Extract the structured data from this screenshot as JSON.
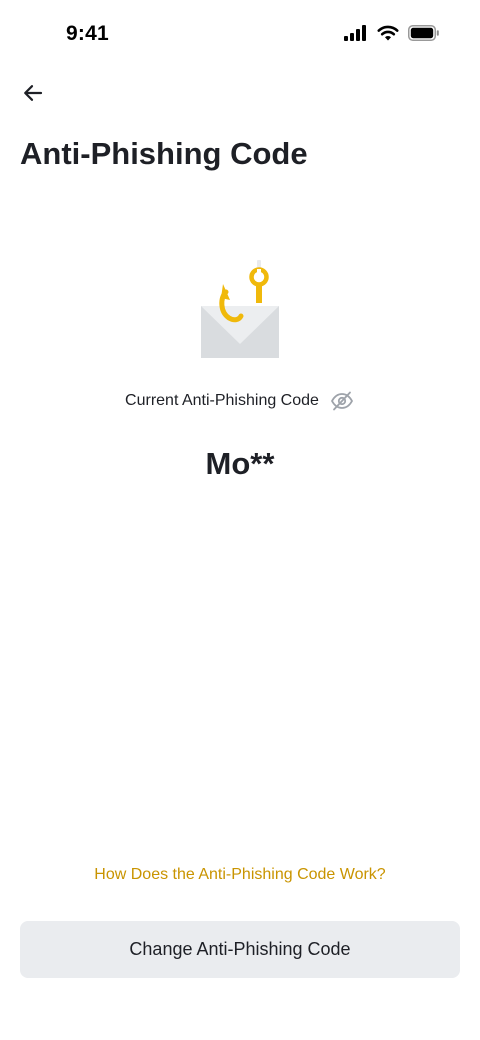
{
  "status_bar": {
    "time": "9:41",
    "icons": [
      "signal-icon",
      "wifi-icon",
      "battery-icon"
    ]
  },
  "header": {
    "back_icon": "arrow-left-icon",
    "title": "Anti-Phishing Code"
  },
  "illustration": {
    "icon": "envelope-with-fishing-hook-icon"
  },
  "current_code": {
    "label": "Current Anti-Phishing Code",
    "toggle_icon": "eye-off-icon",
    "value": "Mo**"
  },
  "help": {
    "link_text": "How Does the Anti-Phishing Code Work?"
  },
  "actions": {
    "change_label": "Change Anti-Phishing Code"
  },
  "colors": {
    "text_primary": "#1e2026",
    "link": "#c99400",
    "button_bg": "#eaecef",
    "hook": "#f0b90b",
    "envelope": "#d9dcdf",
    "eye_icon": "#9ea3aa"
  }
}
